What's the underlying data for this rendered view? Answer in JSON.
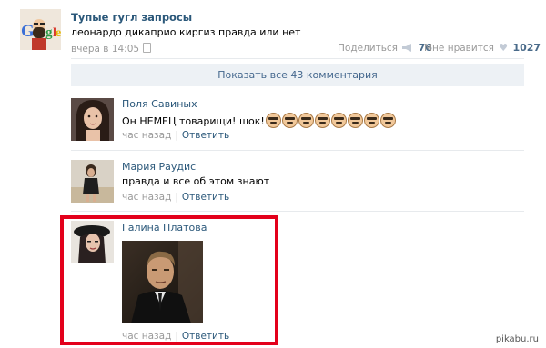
{
  "post": {
    "title": "Тупые гугл запросы",
    "text": "леонардо дикаприо киргиз правда или нет",
    "time": "вчера в 14:05",
    "share_label": "Поделиться",
    "share_count": "76",
    "like_label": "Мне нравится",
    "like_count": "1027",
    "avatar_icon": "google-logo-icon"
  },
  "show_all": "Показать все 43 комментария",
  "comments": [
    {
      "author": "Поля Савиных",
      "text": "Он НЕМЕЦ товарищи! шок!",
      "emoji_icon": "mustache-face-emoji-icon",
      "time": "час назад",
      "reply": "Ответить"
    },
    {
      "author": "Мария Раудис",
      "text": "правда и все об этом знают",
      "time": "час назад",
      "reply": "Ответить"
    },
    {
      "author": "Галина Платова",
      "attachment": "photo",
      "time": "час назад",
      "reply": "Ответить"
    }
  ],
  "highlight_color": "#e3001b",
  "watermark": "pikabu.ru"
}
